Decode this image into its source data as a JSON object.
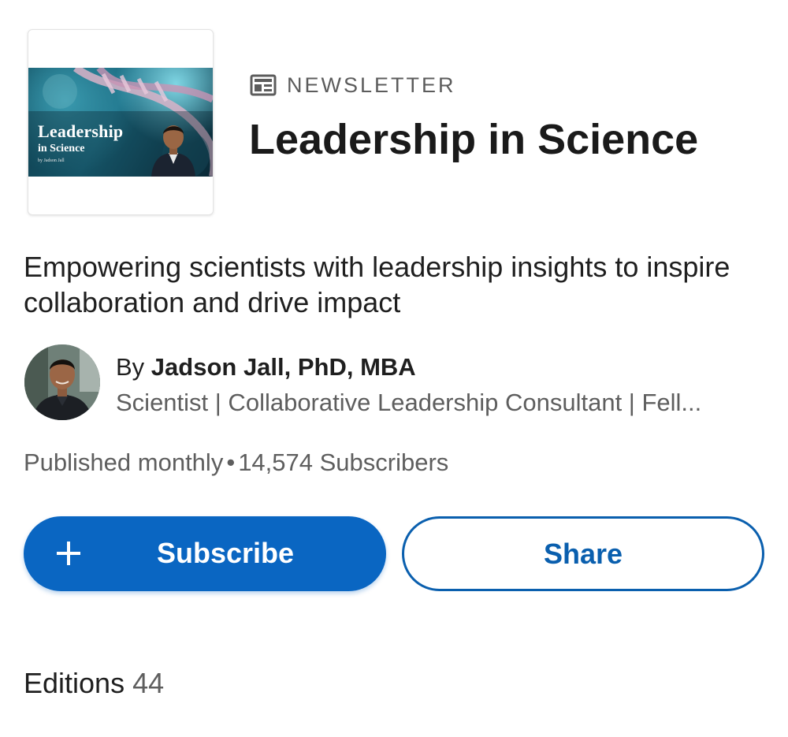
{
  "colors": {
    "brand_blue": "#0a66c2",
    "share_outline": "#0a5fae",
    "muted_text": "#5e5e5e",
    "primary_text": "#1f1f1f"
  },
  "cover": {
    "title": "Leadership",
    "subtitle": "in Science",
    "byline": "by Jadson Jall",
    "image_icon": "dna-helix-portrait-image"
  },
  "header": {
    "kicker_icon": "newsletter-icon",
    "kicker": "NEWSLETTER",
    "title": "Leadership in Science"
  },
  "description": "Empowering scientists with leadership insights to inspire collaboration and drive impact",
  "author": {
    "avatar_icon": "avatar-photo",
    "by_prefix": "By ",
    "name": "Jadson Jall, PhD, MBA",
    "headline": "Scientist | Collaborative Leadership Consultant | Fell..."
  },
  "meta": {
    "frequency": "Published monthly",
    "separator": "•",
    "subscribers": "14,574 Subscribers"
  },
  "actions": {
    "subscribe_icon": "plus-icon",
    "subscribe_label": "Subscribe",
    "share_label": "Share"
  },
  "editions": {
    "label": "Editions",
    "count": "44"
  }
}
